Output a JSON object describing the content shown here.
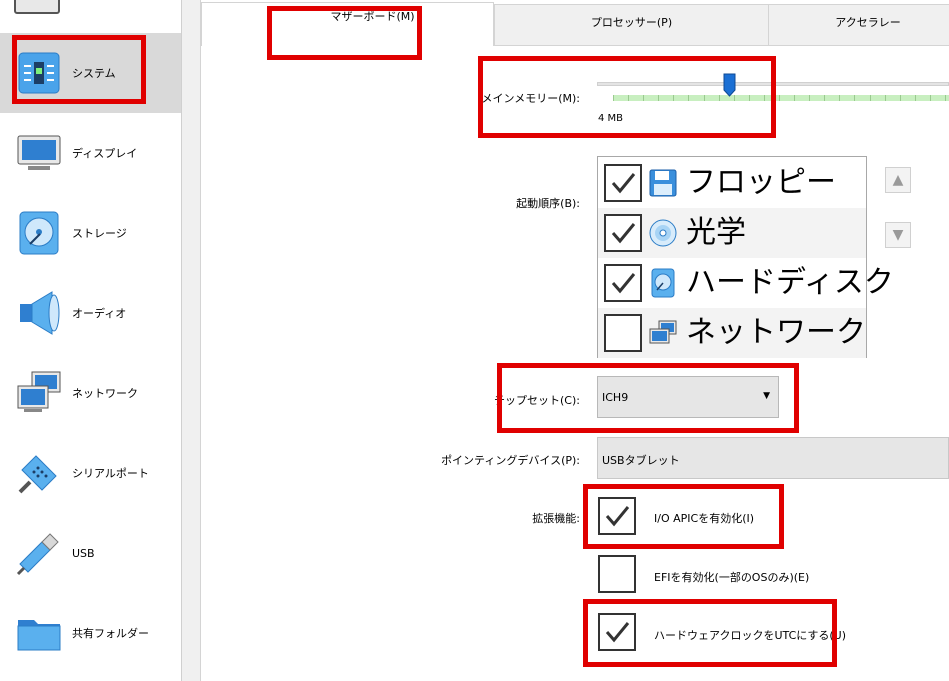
{
  "sidebar": {
    "items": [
      {
        "label": "システム",
        "icon": "system-chip-icon",
        "selected": true
      },
      {
        "label": "ディスプレイ",
        "icon": "monitor-icon"
      },
      {
        "label": "ストレージ",
        "icon": "disk-icon"
      },
      {
        "label": "オーディオ",
        "icon": "speaker-icon"
      },
      {
        "label": "ネットワーク",
        "icon": "network-monitors-icon"
      },
      {
        "label": "シリアルポート",
        "icon": "serial-plug-icon"
      },
      {
        "label": "USB",
        "icon": "usb-plug-icon"
      },
      {
        "label": "共有フォルダー",
        "icon": "folder-icon"
      }
    ]
  },
  "tabs": [
    {
      "label": "マザーボード(M)",
      "active": true
    },
    {
      "label": "プロセッサー(P)"
    },
    {
      "label": "アクセラレー"
    }
  ],
  "memory": {
    "label": "メインメモリー(M):",
    "min_label": "4 MB",
    "position": 0.37
  },
  "boot": {
    "label": "起動順序(B):",
    "items": [
      {
        "label": "フロッピー",
        "checked": true,
        "icon": "floppy-icon"
      },
      {
        "label": "光学",
        "checked": true,
        "icon": "optical-disc-icon"
      },
      {
        "label": "ハードディスク",
        "checked": true,
        "icon": "hard-disk-icon"
      },
      {
        "label": "ネットワーク",
        "checked": false,
        "icon": "network-icon"
      }
    ]
  },
  "chipset": {
    "label": "チップセット(C):",
    "value": "ICH9"
  },
  "pointing": {
    "label": "ポインティングデバイス(P):",
    "value": "USBタブレット"
  },
  "extended": {
    "label": "拡張機能:",
    "options": [
      {
        "label": "I/O APICを有効化(I)",
        "checked": true
      },
      {
        "label": "EFIを有効化(一部のOSのみ)(E)",
        "checked": false
      },
      {
        "label": "ハードウェアクロックをUTCにする(U)",
        "checked": true
      }
    ]
  },
  "colors": {
    "highlight": "#e00000",
    "slider_green": "#c8efc0",
    "thumb_blue": "#1a6fd4",
    "selected_bg": "#d9d9d9"
  }
}
